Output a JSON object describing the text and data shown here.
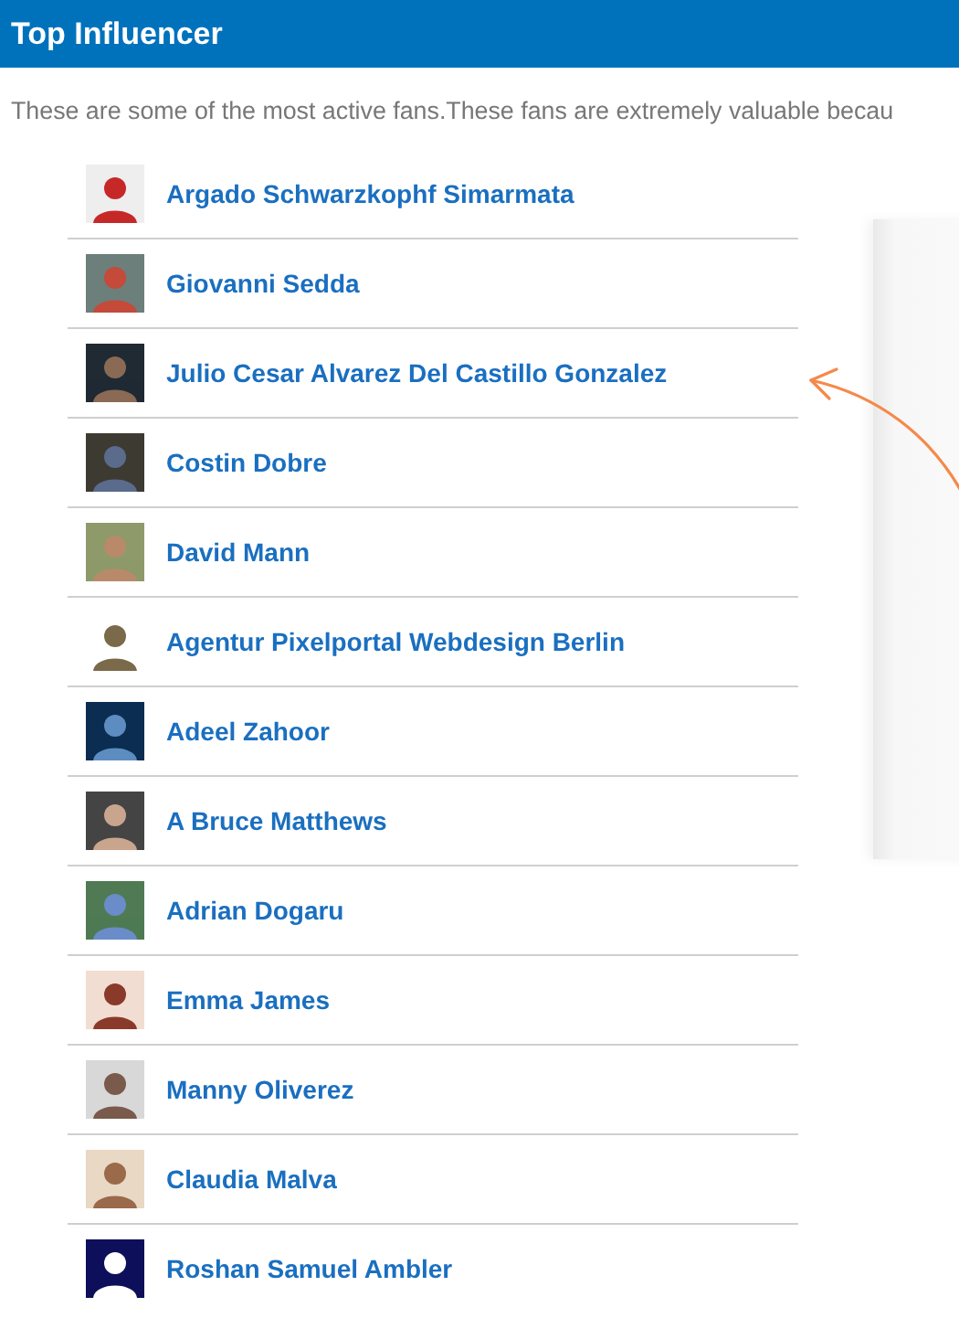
{
  "header": {
    "title": "Top Influencer"
  },
  "intro": "These are some of the most active fans.These fans are extremely valuable becau",
  "influencers": [
    {
      "name": "Argado Schwarzkophf Simarmata"
    },
    {
      "name": "Giovanni Sedda"
    },
    {
      "name": "Julio Cesar Alvarez Del Castillo Gonzalez"
    },
    {
      "name": "Costin Dobre"
    },
    {
      "name": "David Mann"
    },
    {
      "name": "Agentur Pixelportal Webdesign Berlin"
    },
    {
      "name": "Adeel Zahoor"
    },
    {
      "name": "A Bruce Matthews"
    },
    {
      "name": "Adrian Dogaru"
    },
    {
      "name": "Emma James"
    },
    {
      "name": "Manny Oliverez"
    },
    {
      "name": "Claudia Malva"
    },
    {
      "name": "Roshan Samuel Ambler"
    }
  ]
}
